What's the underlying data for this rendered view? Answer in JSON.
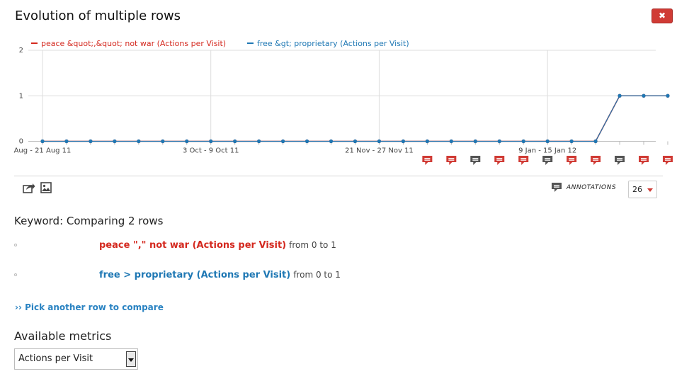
{
  "dialog": {
    "title": "Evolution of multiple rows",
    "close_label": "✖"
  },
  "colors": {
    "series1": "#d4291f",
    "series2": "#1f78b4",
    "annotation_red": "#d03b35",
    "annotation_gray": "#555555",
    "link": "#2a83c2"
  },
  "chart_data": {
    "type": "line",
    "x_tick_labels": [
      "Aug - 21 Aug 11",
      "3 Oct - 9 Oct 11",
      "21 Nov - 27 Nov 11",
      "9 Jan - 15 Jan 12"
    ],
    "y_ticks": [
      "2",
      "1",
      "0"
    ],
    "ylim": [
      0,
      2
    ],
    "grid": true,
    "legend_position": "top-left",
    "series": [
      {
        "name": "peace &quot;,&quot; not war (Actions per Visit)",
        "values": [
          0,
          0,
          0,
          0,
          0,
          0,
          0,
          0,
          0,
          0,
          0,
          0,
          0,
          0,
          0,
          0,
          0,
          0,
          0,
          0,
          0,
          0,
          0,
          0,
          1,
          1,
          1
        ]
      },
      {
        "name": "free &gt; proprietary (Actions per Visit)",
        "values": [
          0,
          0,
          0,
          0,
          0,
          0,
          0,
          0,
          0,
          0,
          0,
          0,
          0,
          0,
          0,
          0,
          0,
          0,
          0,
          0,
          0,
          0,
          0,
          0,
          1,
          1,
          1
        ]
      }
    ],
    "annotation_markers": [
      "red",
      "red",
      "gray",
      "red",
      "red",
      "gray",
      "red",
      "red",
      "gray",
      "red",
      "red"
    ]
  },
  "toolbar": {
    "annotations_label": "ANNOTATIONS",
    "period_value": "26"
  },
  "compare": {
    "heading": "Keyword: Comparing 2 rows",
    "rows": [
      {
        "label": "peace \",\" not war (Actions per Visit)",
        "range": "from 0 to 1"
      },
      {
        "label": "free > proprietary (Actions per Visit)",
        "range": "from 0 to 1"
      }
    ],
    "pick_link": "›› Pick another row to compare"
  },
  "metrics": {
    "heading": "Available metrics",
    "selected": "Actions per Visit"
  }
}
